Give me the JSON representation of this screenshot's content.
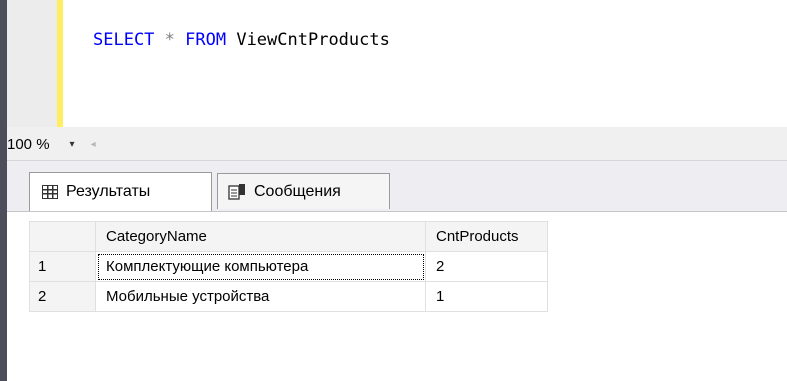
{
  "editor": {
    "tokens": [
      {
        "text": "SELECT",
        "kind": "keyword"
      },
      {
        "text": " * ",
        "kind": "operator"
      },
      {
        "text": "FROM",
        "kind": "keyword"
      },
      {
        "text": " ViewCntProducts",
        "kind": "identifier"
      }
    ]
  },
  "status": {
    "zoom_value": "100 %",
    "zoom_dropdown_glyph": "▾",
    "scroll_left_glyph": "◂"
  },
  "tabs": [
    {
      "label": "Результаты",
      "icon": "grid-icon",
      "active": true
    },
    {
      "label": "Сообщения",
      "icon": "messages-icon",
      "active": false
    }
  ],
  "grid": {
    "columns": [
      "CategoryName",
      "CntProducts"
    ],
    "rows": [
      {
        "num": "1",
        "cells": [
          "Комплектующие компьютера",
          "2"
        ]
      },
      {
        "num": "2",
        "cells": [
          "Мобильные устройства",
          "1"
        ]
      }
    ]
  },
  "colors": {
    "keyword": "#0000ff",
    "operator": "#808080",
    "change_bar": "#ffee62",
    "left_bar": "#4d4d5c"
  }
}
